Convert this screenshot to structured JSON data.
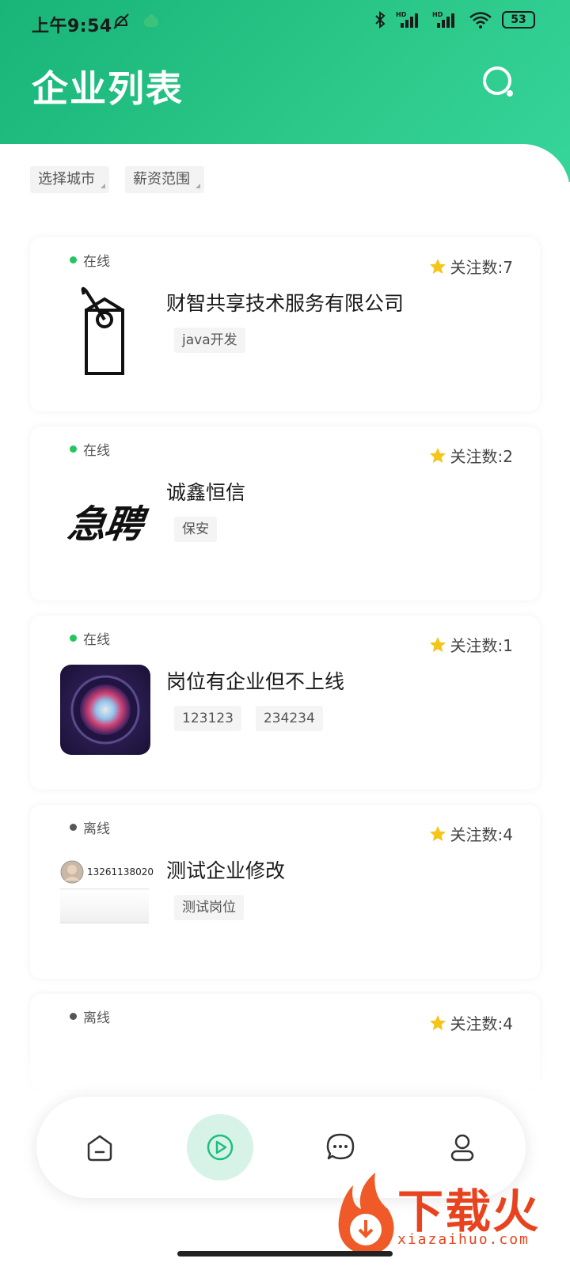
{
  "status_bar": {
    "time": "上午9:54",
    "battery": "53"
  },
  "header": {
    "title": "企业列表"
  },
  "filters": [
    {
      "label": "选择城市"
    },
    {
      "label": "薪资范围"
    }
  ],
  "cards": [
    {
      "status": "在线",
      "online": true,
      "follow": "关注数:7",
      "company": "财智共享技术服务有限公司",
      "tags": [
        "java开发"
      ],
      "logo": "price-tag"
    },
    {
      "status": "在线",
      "online": true,
      "follow": "关注数:2",
      "company": "诚鑫恒信",
      "tags": [
        "保安"
      ],
      "logo": "urgent-hiring",
      "logo_text": "急聘"
    },
    {
      "status": "在线",
      "online": true,
      "follow": "关注数:1",
      "company": "岗位有企业但不上线",
      "tags": [
        "123123",
        "234234"
      ],
      "logo": "siri-orb"
    },
    {
      "status": "离线",
      "online": false,
      "follow": "关注数:4",
      "company": "测试企业修改",
      "tags": [
        "测试岗位"
      ],
      "logo": "profile-screenshot",
      "logo_text": "13261138020"
    },
    {
      "status": "离线",
      "online": false,
      "follow": "关注数:4",
      "company": "",
      "tags": [],
      "logo": ""
    }
  ],
  "watermark": {
    "text": "下载火",
    "sub": "xiazaihuo.com"
  },
  "colors": {
    "brand_green": "#1fbd80",
    "online": "#22c55e",
    "offline": "#555555",
    "star": "#f5c518"
  }
}
